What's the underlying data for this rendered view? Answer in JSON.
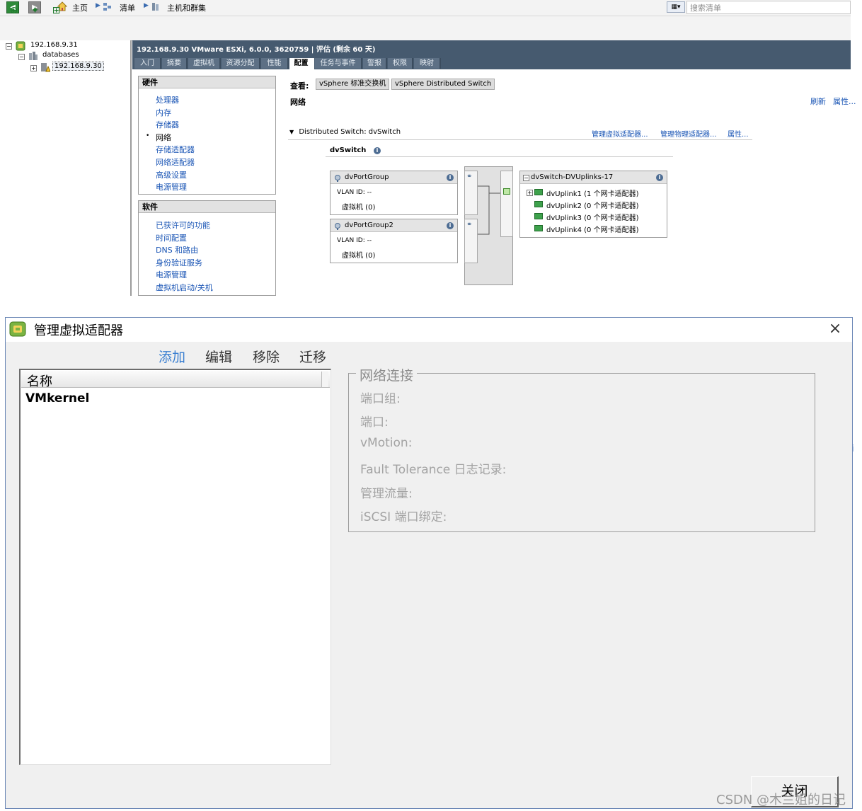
{
  "client": {
    "breadcrumb": {
      "home": "主页",
      "inventory": "清单",
      "hosts": "主机和群集"
    },
    "search": {
      "placeholder": "搜索清单"
    },
    "tree": {
      "vcenter": "192.168.9.31",
      "datacenter": "databases",
      "host": "192.168.9.30"
    },
    "host_title": "192.168.9.30 VMware ESXi, 6.0.0, 3620759 | 评估 (剩余 60 天)",
    "tabs": [
      "入门",
      "摘要",
      "虚拟机",
      "资源分配",
      "性能",
      "配置",
      "任务与事件",
      "警报",
      "权限",
      "映射"
    ],
    "active_tab": "配置",
    "hardware": {
      "header": "硬件",
      "items": [
        "处理器",
        "内存",
        "存储器",
        "网络",
        "存储适配器",
        "网络适配器",
        "高级设置",
        "电源管理"
      ],
      "selected": "网络"
    },
    "software": {
      "header": "软件",
      "items": [
        "已获许可的功能",
        "时间配置",
        "DNS 和路由",
        "身份验证服务",
        "电源管理",
        "虚拟机启动/关机"
      ]
    },
    "view": {
      "label": "查看:",
      "buttons": [
        "vSphere 标准交换机",
        "vSphere Distributed Switch"
      ],
      "section_title": "网络",
      "refresh": "刷新",
      "properties": "属性..."
    },
    "distributed_switch": {
      "header": "Distributed Switch: dvSwitch",
      "manage_virtual": "管理虚拟适配器...",
      "manage_physical": "管理物理适配器...",
      "properties": "属性...",
      "name": "dvSwitch",
      "port_groups": [
        {
          "name": "dvPortGroup",
          "vlan": "VLAN ID: --",
          "vms": "虚拟机 (0)"
        },
        {
          "name": "dvPortGroup2",
          "vlan": "VLAN ID: --",
          "vms": "虚拟机 (0)"
        }
      ],
      "uplinks": {
        "name": "dvSwitch-DVUplinks-17",
        "items": [
          "dvUplink1 (1 个网卡适配器)",
          "dvUplink2 (0 个网卡适配器)",
          "dvUplink3 (0 个网卡适配器)",
          "dvUplink4 (0 个网卡适配器)"
        ]
      }
    }
  },
  "dialog": {
    "title": "管理虚拟适配器",
    "close_x": "×",
    "actions": [
      "添加",
      "编辑",
      "移除",
      "迁移"
    ],
    "list": {
      "column": "名称",
      "rows": [
        "VMkernel"
      ]
    },
    "connection": {
      "legend": "网络连接",
      "fields": [
        "端口组:",
        "端口:",
        "vMotion:",
        "Fault Tolerance 日志记录:",
        "管理流量:",
        "iSCSI 端口绑定:"
      ]
    },
    "close_button": "关闭"
  },
  "watermark": "CSDN @木兰姐的日记",
  "colors": {
    "host_bar": "#465a6f",
    "link": "#1a55b5",
    "action_primary": "#3a7fd1",
    "dialog_bg": "#f0f0f0",
    "disabled_text": "#a3a3a3"
  }
}
